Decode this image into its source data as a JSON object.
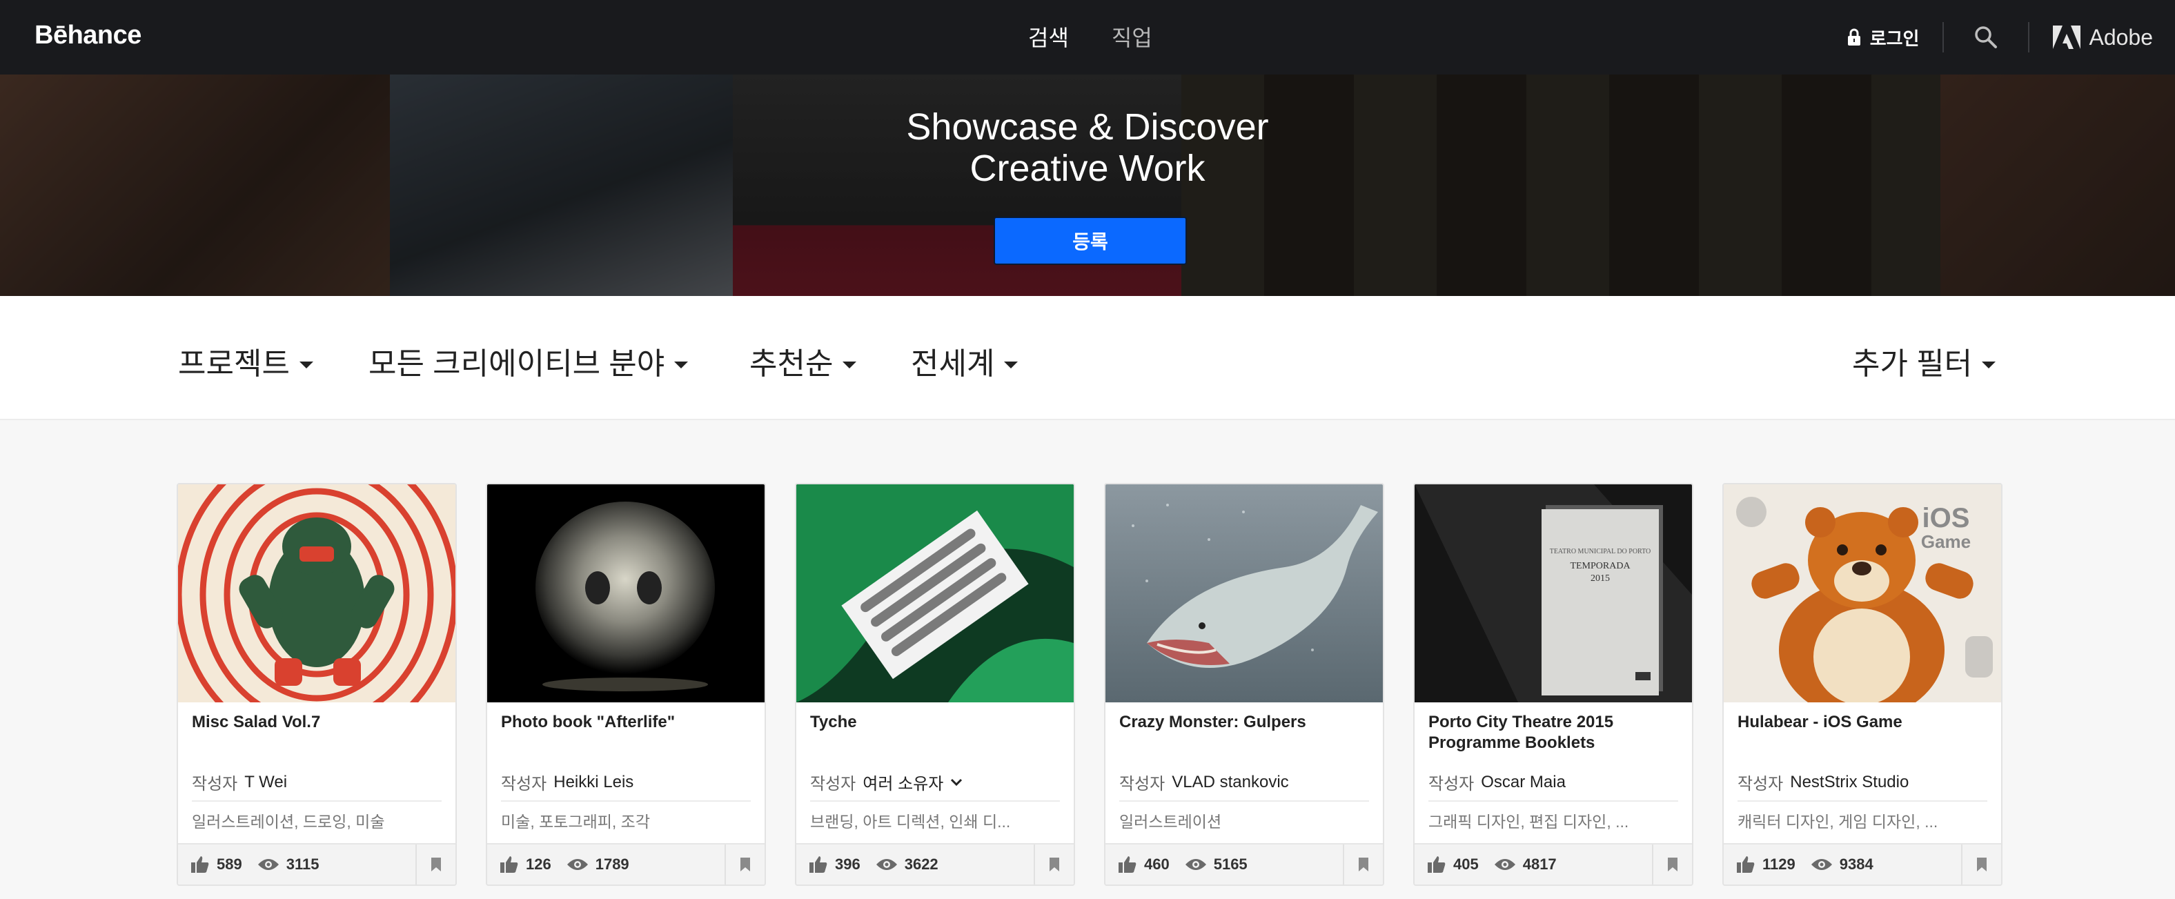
{
  "header": {
    "logo": "Bēhance",
    "nav": [
      {
        "label": "검색",
        "active": true
      },
      {
        "label": "직업",
        "active": false
      }
    ],
    "login_label": "로그인",
    "adobe_label": "Adobe"
  },
  "hero": {
    "title_line1": "Showcase & Discover",
    "title_line2": "Creative Work",
    "signup_label": "등록"
  },
  "filters": {
    "type": "프로젝트",
    "field": "모든 크리에이티브 분야",
    "sort": "추천순",
    "location": "전세계",
    "more": "추가 필터"
  },
  "colors": {
    "topbar": "#191a1d",
    "accent_button": "#0b69ff",
    "page_bg": "#f7f7f7"
  },
  "projects": [
    {
      "title": "Misc Salad Vol.7",
      "owner_label": "작성자",
      "owner": "T Wei",
      "fields": "일러스트레이션, 드로잉, 미술",
      "likes": "589",
      "views": "3115",
      "multi_owner": false
    },
    {
      "title": "Photo book \"Afterlife\"",
      "owner_label": "작성자",
      "owner": "Heikki Leis",
      "fields": "미술, 포토그래피, 조각",
      "likes": "126",
      "views": "1789",
      "multi_owner": false
    },
    {
      "title": "Tyche",
      "owner_label": "작성자",
      "owner": "여러 소유자",
      "fields": "브랜딩, 아트 디렉션, 인쇄 디...",
      "likes": "396",
      "views": "3622",
      "multi_owner": true
    },
    {
      "title": "Crazy Monster: Gulpers",
      "owner_label": "작성자",
      "owner": "VLAD stankovic",
      "fields": "일러스트레이션",
      "likes": "460",
      "views": "5165",
      "multi_owner": false
    },
    {
      "title": "Porto City Theatre 2015 Programme Booklets",
      "owner_label": "작성자",
      "owner": "Oscar Maia",
      "fields": "그래픽 디자인, 편집 디자인, ...",
      "likes": "405",
      "views": "4817",
      "multi_owner": false
    },
    {
      "title": "Hulabear - iOS Game",
      "owner_label": "작성자",
      "owner": "NestStrix Studio",
      "fields": "캐릭터 디자인, 게임 디자인, ...",
      "likes": "1129",
      "views": "9384",
      "multi_owner": false
    }
  ],
  "thumb_text": {
    "book_line1": "TEATRO MUNICIPAL DO PORTO",
    "book_line2": "TEMPORADA",
    "book_line3": "2015",
    "game_line1": "iOS",
    "game_line2": "Game"
  }
}
